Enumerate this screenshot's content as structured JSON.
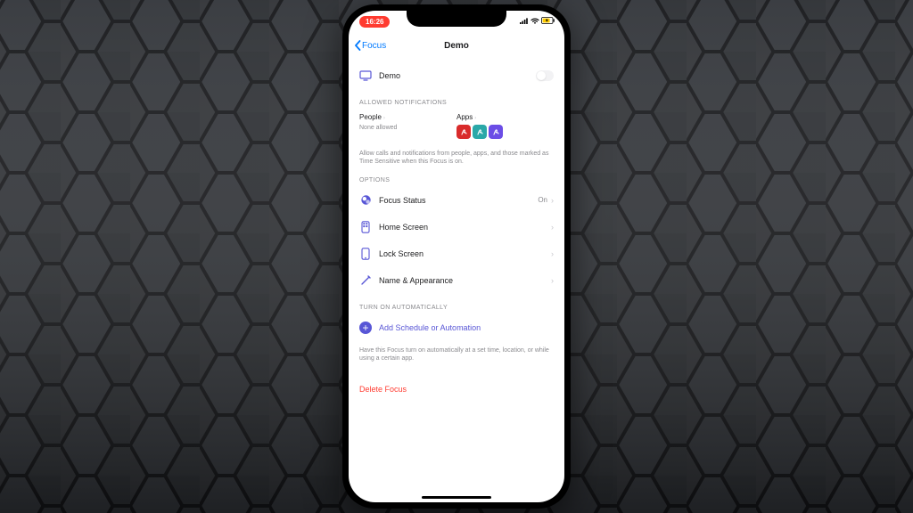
{
  "status": {
    "time": "16:26"
  },
  "nav": {
    "back": "Focus",
    "title": "Demo"
  },
  "focus_row": {
    "label": "Demo"
  },
  "allowed": {
    "header": "ALLOWED NOTIFICATIONS",
    "people_label": "People",
    "people_sub": "None allowed",
    "apps_label": "Apps",
    "footer": "Allow calls and notifications from people, apps, and those marked as Time Sensitive when this Focus is on."
  },
  "options": {
    "header": "OPTIONS",
    "items": [
      {
        "label": "Focus Status",
        "value": "On"
      },
      {
        "label": "Home Screen",
        "value": ""
      },
      {
        "label": "Lock Screen",
        "value": ""
      },
      {
        "label": "Name & Appearance",
        "value": ""
      }
    ]
  },
  "auto": {
    "header": "TURN ON AUTOMATICALLY",
    "add": "Add Schedule or Automation",
    "footer": "Have this Focus turn on automatically at a set time, location, or while using a certain app."
  },
  "delete": "Delete Focus"
}
